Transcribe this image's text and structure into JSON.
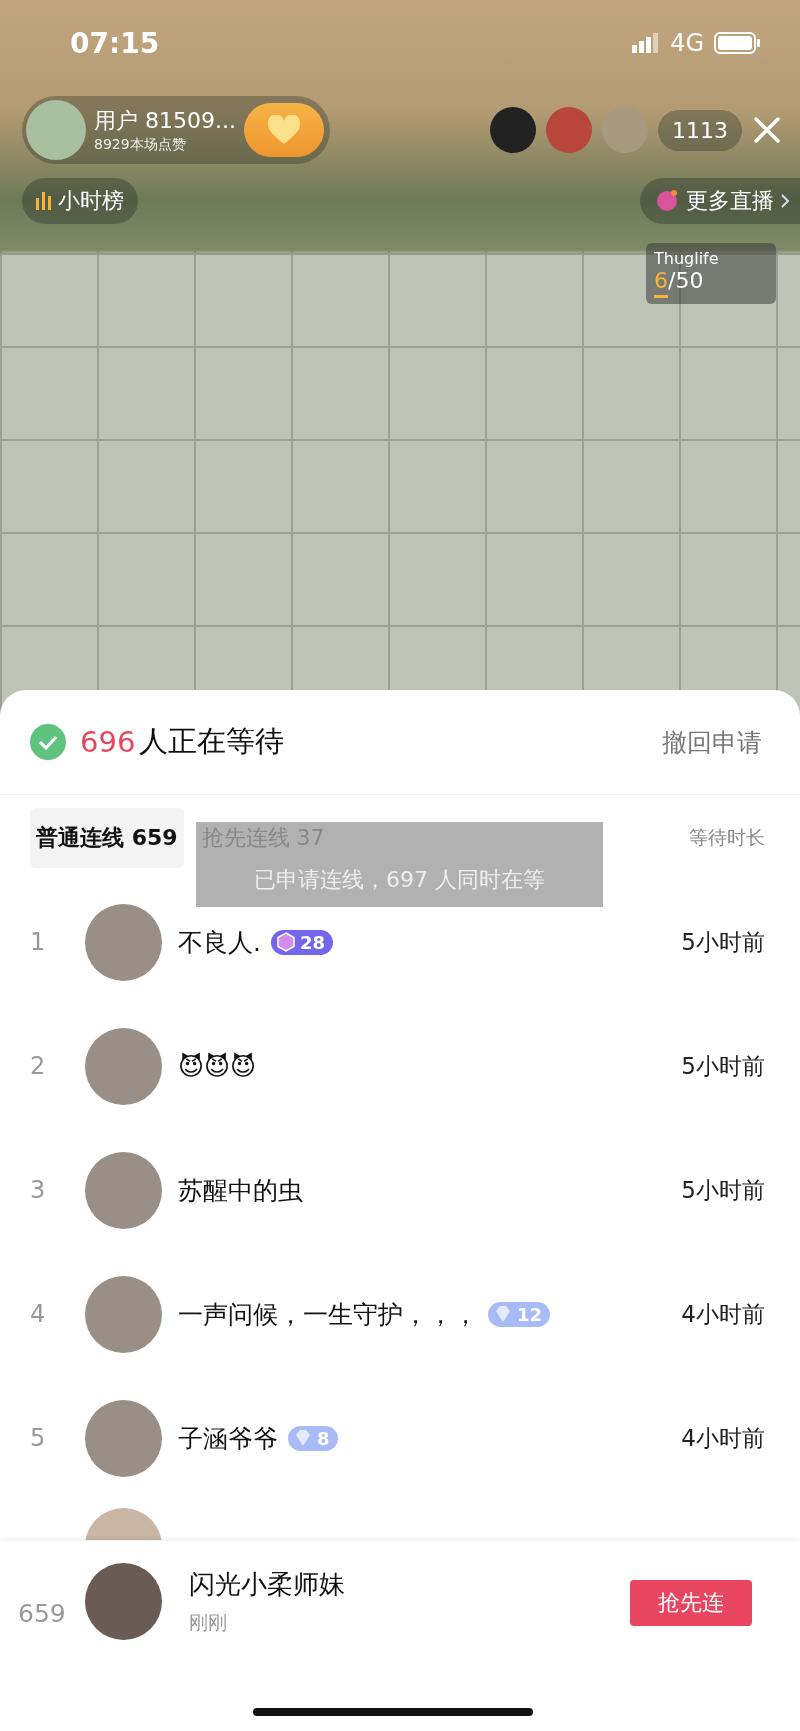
{
  "status_bar": {
    "time": "07:15",
    "network": "4G"
  },
  "host": {
    "name": "用户 81509...",
    "likes": "8929本场点赞"
  },
  "viewers": {
    "count": "1113"
  },
  "hourly_rank": {
    "label": "小时榜"
  },
  "more_live": {
    "label": "更多直播"
  },
  "game_widget": {
    "name": "Thuglife",
    "current": "6",
    "total": "/50",
    "level": 0.12
  },
  "panel": {
    "count": "696",
    "waiting_text": "人正在等待",
    "withdraw": "撤回申请"
  },
  "tabs": [
    {
      "label": "普通连线 659",
      "selected": true
    },
    {
      "label": "抢先连线 37",
      "selected": false
    }
  ],
  "wait_column": "等待时长",
  "toast": "已申请连线，697 人同时在等",
  "queue": [
    {
      "rank": "1",
      "name": "不良人.",
      "badge": {
        "kind": "hexagon",
        "value": "28"
      },
      "time": "5小时前"
    },
    {
      "rank": "2",
      "name": "😈😈😈",
      "time": "5小时前"
    },
    {
      "rank": "3",
      "name": "苏醒中的虫",
      "time": "5小时前"
    },
    {
      "rank": "4",
      "name": "一声问候，一生守护，，，",
      "badge": {
        "kind": "gem",
        "value": "12"
      },
      "time": "4小时前"
    },
    {
      "rank": "5",
      "name": "子涵爷爷",
      "badge": {
        "kind": "gem",
        "value": "8"
      },
      "time": "4小时前"
    }
  ],
  "me": {
    "rank": "659",
    "name": "闪光小柔师妹",
    "time": "刚刚",
    "button": "抢先连"
  }
}
